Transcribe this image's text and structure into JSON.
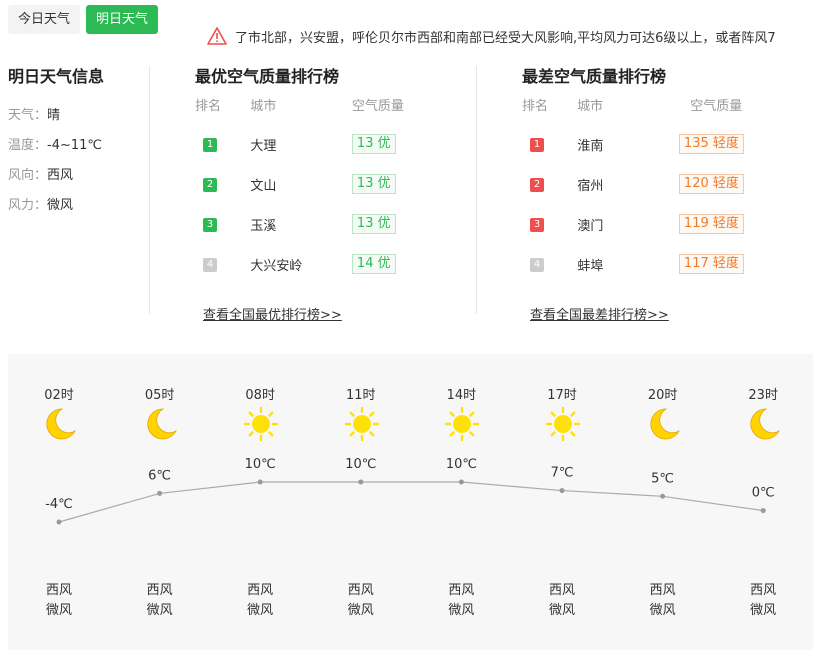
{
  "tabs": {
    "today": "今日天气",
    "tomorrow": "明日天气"
  },
  "alert": {
    "text": "了市北部，兴安盟，呼伦贝尔市西部和南部已经受大风影响,平均风力可达6级以上，或者阵风7"
  },
  "info": {
    "title": "明日天气信息",
    "rows": [
      {
        "k": "天气：",
        "v": "晴"
      },
      {
        "k": "温度：",
        "v": "-4~11℃"
      },
      {
        "k": "风向：",
        "v": "西风"
      },
      {
        "k": "风力：",
        "v": "微风"
      }
    ]
  },
  "best": {
    "title": "最优空气质量排行榜",
    "headers": [
      "排名",
      "城市",
      "空气质量"
    ],
    "rows": [
      {
        "rank": "1",
        "city": "大理",
        "aqi": "13 优"
      },
      {
        "rank": "2",
        "city": "文山",
        "aqi": "13 优"
      },
      {
        "rank": "3",
        "city": "玉溪",
        "aqi": "13 优"
      },
      {
        "rank": "4",
        "city": "大兴安岭",
        "aqi": "14 优"
      }
    ],
    "more": "查看全国最优排行榜>>"
  },
  "worst": {
    "title": "最差空气质量排行榜",
    "headers": [
      "排名",
      "城市",
      "空气质量"
    ],
    "rows": [
      {
        "rank": "1",
        "city": "淮南",
        "aqi": "135 轻度"
      },
      {
        "rank": "2",
        "city": "宿州",
        "aqi": "120 轻度"
      },
      {
        "rank": "3",
        "city": "澳门",
        "aqi": "119 轻度"
      },
      {
        "rank": "4",
        "city": "蚌埠",
        "aqi": "117 轻度"
      }
    ],
    "more": "查看全国最差排行榜>>"
  },
  "colors": {
    "accent": "#2dba55",
    "red": "#ee4e4e",
    "orange": "#f07a2c",
    "sun": "#ffe10a",
    "moon": "#ffd200"
  },
  "hourly": [
    {
      "time": "02时",
      "icon": "moon-icon",
      "temp": "-4℃",
      "t": -4,
      "dir": "西风",
      "pow": "微风"
    },
    {
      "time": "05时",
      "icon": "moon-icon",
      "temp": "6℃",
      "t": 6,
      "dir": "西风",
      "pow": "微风"
    },
    {
      "time": "08时",
      "icon": "sun-icon",
      "temp": "10℃",
      "t": 10,
      "dir": "西风",
      "pow": "微风"
    },
    {
      "time": "11时",
      "icon": "sun-icon",
      "temp": "10℃",
      "t": 10,
      "dir": "西风",
      "pow": "微风"
    },
    {
      "time": "14时",
      "icon": "sun-icon",
      "temp": "10℃",
      "t": 10,
      "dir": "西风",
      "pow": "微风"
    },
    {
      "time": "17时",
      "icon": "sun-icon",
      "temp": "7℃",
      "t": 7,
      "dir": "西风",
      "pow": "微风"
    },
    {
      "time": "20时",
      "icon": "moon-icon",
      "temp": "5℃",
      "t": 5,
      "dir": "西风",
      "pow": "微风"
    },
    {
      "time": "23时",
      "icon": "moon-icon",
      "temp": "0℃",
      "t": 0,
      "dir": "西风",
      "pow": "微风"
    }
  ]
}
